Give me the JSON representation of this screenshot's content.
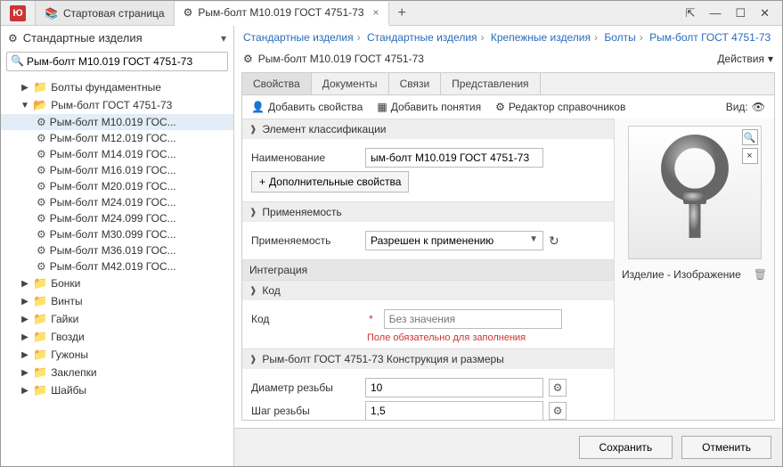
{
  "titlebar": {
    "start_tab": "Стартовая страница",
    "active_tab": "Рым-болт М10.019 ГОСТ 4751-73"
  },
  "sidebar": {
    "title": "Стандартные изделия",
    "search_value": "Рым-болт М10.019 ГОСТ 4751-73",
    "tree": {
      "f_fund": "Болты фундаментные",
      "f_rym": "Рым-болт ГОСТ 4751-73",
      "items": [
        "Рым-болт М10.019 ГОС...",
        "Рым-болт М12.019 ГОС...",
        "Рым-болт М14.019 ГОС...",
        "Рым-болт М16.019 ГОС...",
        "Рым-болт М20.019 ГОС...",
        "Рым-болт М24.019 ГОС...",
        "Рым-болт М24.099 ГОС...",
        "Рым-болт М30.099 ГОС...",
        "Рым-болт М36.019 ГОС...",
        "Рым-болт М42.019 ГОС..."
      ],
      "f_bonki": "Бонки",
      "f_vinty": "Винты",
      "f_gaiki": "Гайки",
      "f_gvozdi": "Гвозди",
      "f_guzhony": "Гужоны",
      "f_zaklepki": "Заклепки",
      "f_shaiby": "Шайбы"
    }
  },
  "breadcrumb": [
    "Стандартные изделия",
    "Стандартные изделия",
    "Крепежные изделия",
    "Болты",
    "Рым-болт ГОСТ 4751-73"
  ],
  "page_title": "Рым-болт М10.019 ГОСТ 4751-73",
  "actions_label": "Действия",
  "tabs": {
    "t1": "Свойства",
    "t2": "Документы",
    "t3": "Связи",
    "t4": "Представления"
  },
  "toolbar": {
    "add_props": "Добавить свойства",
    "add_concepts": "Добавить понятия",
    "editor": "Редактор справочников",
    "view": "Вид:"
  },
  "groups": {
    "g1": "Элемент классификации",
    "g2": "Применяемость",
    "g3": "Интеграция",
    "g4": "Код",
    "g5": "Рым-болт ГОСТ 4751-73 Конструкция и размеры"
  },
  "props": {
    "name_lbl": "Наименование",
    "name_val": "ым-болт М10.019 ГОСТ 4751-73",
    "more_btn": "Дополнительные свойства",
    "apply_lbl": "Применяемость",
    "apply_val": "Разрешен к применению",
    "code_lbl": "Код",
    "code_ph": "Без значения",
    "code_err": "Поле обязательно для заполнения",
    "diam_lbl": "Диаметр резьбы",
    "diam_val": "10",
    "pitch_lbl": "Шаг резьбы",
    "pitch_val": "1,5"
  },
  "preview": {
    "caption": "Изделие  - Изображение"
  },
  "footer": {
    "save": "Сохранить",
    "cancel": "Отменить"
  }
}
